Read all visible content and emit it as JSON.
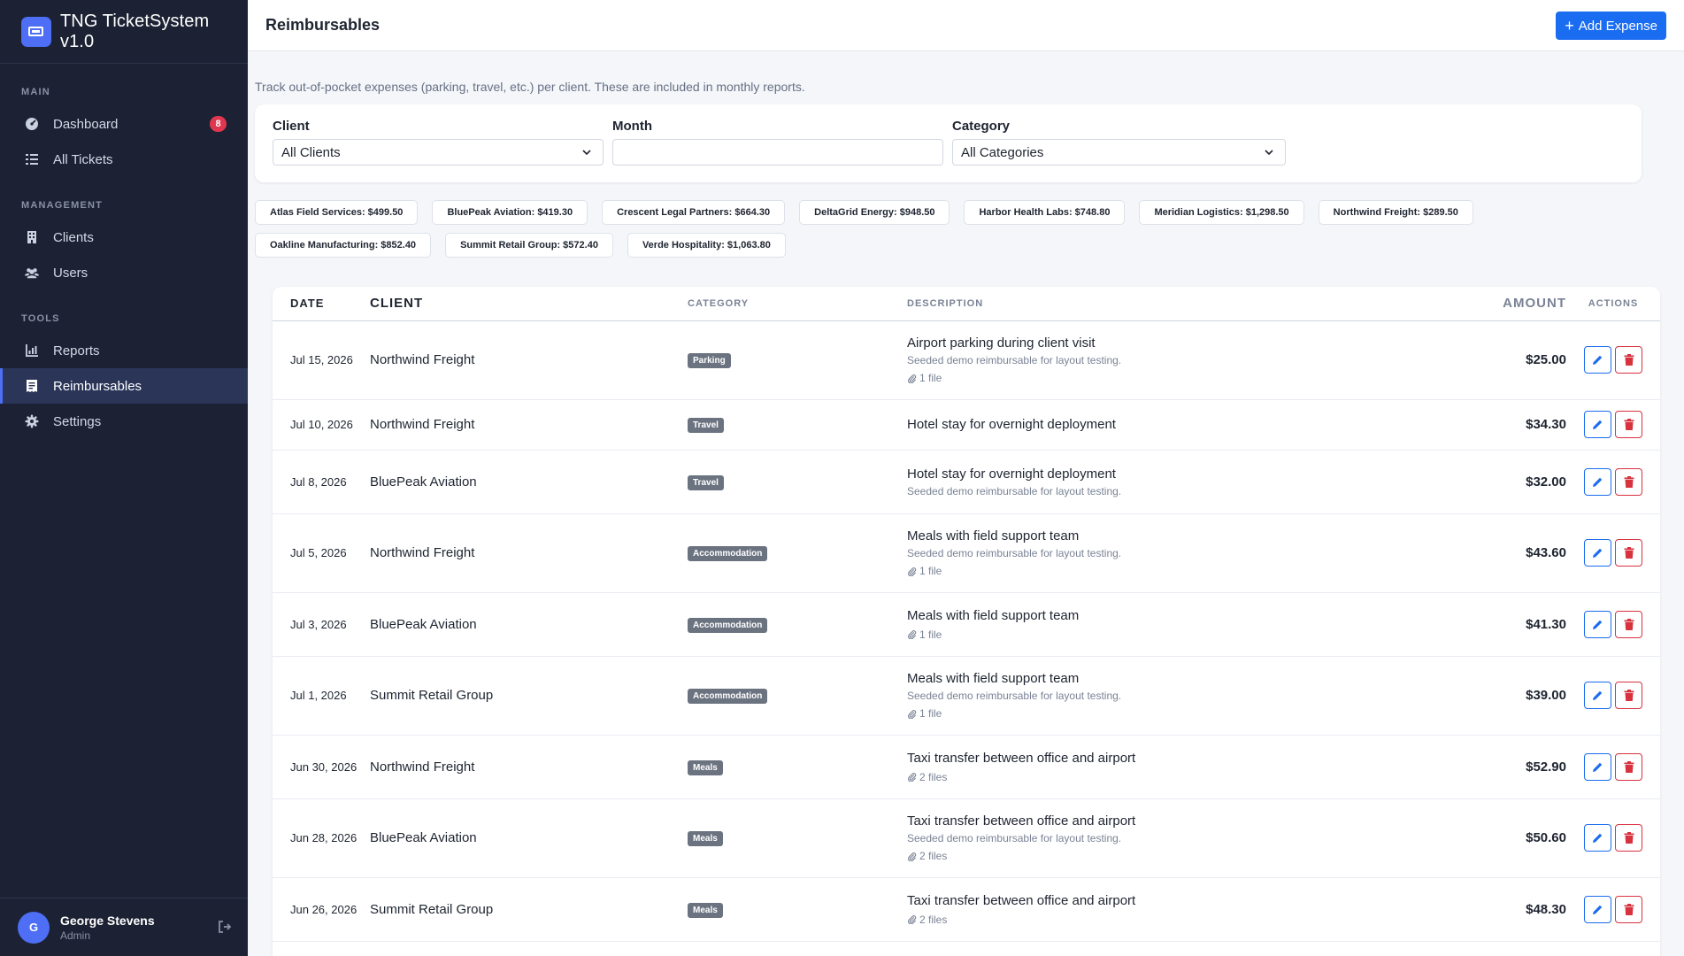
{
  "app": {
    "title": "TNG TicketSystem v1.0"
  },
  "sidebar": {
    "sections": [
      {
        "label": "MAIN",
        "items": [
          {
            "label": "Dashboard",
            "icon": "gauge-icon",
            "badge": "8"
          },
          {
            "label": "All Tickets",
            "icon": "list-icon"
          }
        ]
      },
      {
        "label": "MANAGEMENT",
        "items": [
          {
            "label": "Clients",
            "icon": "building-icon"
          },
          {
            "label": "Users",
            "icon": "users-icon"
          }
        ]
      },
      {
        "label": "TOOLS",
        "items": [
          {
            "label": "Reports",
            "icon": "chart-icon"
          },
          {
            "label": "Reimbursables",
            "icon": "receipt-icon",
            "active": true
          },
          {
            "label": "Settings",
            "icon": "gear-icon"
          }
        ]
      }
    ],
    "user": {
      "initial": "G",
      "name": "George Stevens",
      "role": "Admin"
    }
  },
  "header": {
    "title": "Reimbursables",
    "add_label": "Add Expense"
  },
  "intro": "Track out-of-pocket expenses (parking, travel, etc.) per client. These are included in monthly reports.",
  "filters": {
    "client_label": "Client",
    "client_value": "All Clients",
    "month_label": "Month",
    "month_value": "",
    "category_label": "Category",
    "category_value": "All Categories"
  },
  "totals": [
    "Atlas Field Services: $499.50",
    "BluePeak Aviation: $419.30",
    "Crescent Legal Partners: $664.30",
    "DeltaGrid Energy: $948.50",
    "Harbor Health Labs: $748.80",
    "Meridian Logistics: $1,298.50",
    "Northwind Freight: $289.50",
    "Oakline Manufacturing: $852.40",
    "Summit Retail Group: $572.40",
    "Verde Hospitality: $1,063.80"
  ],
  "table": {
    "columns": [
      "DATE",
      "CLIENT",
      "CATEGORY",
      "DESCRIPTION",
      "AMOUNT",
      "ACTIONS"
    ],
    "rows": [
      {
        "date": "Jul 15, 2026",
        "client": "Northwind Freight",
        "category": "Parking",
        "desc": "Airport parking during client visit",
        "note": "Seeded demo reimbursable for layout testing.",
        "files": "1 file",
        "amount": "$25.00"
      },
      {
        "date": "Jul 10, 2026",
        "client": "Northwind Freight",
        "category": "Travel",
        "desc": "Hotel stay for overnight deployment",
        "note": "",
        "files": "",
        "amount": "$34.30"
      },
      {
        "date": "Jul 8, 2026",
        "client": "BluePeak Aviation",
        "category": "Travel",
        "desc": "Hotel stay for overnight deployment",
        "note": "Seeded demo reimbursable for layout testing.",
        "files": "",
        "amount": "$32.00"
      },
      {
        "date": "Jul 5, 2026",
        "client": "Northwind Freight",
        "category": "Accommodation",
        "desc": "Meals with field support team",
        "note": "Seeded demo reimbursable for layout testing.",
        "files": "1 file",
        "amount": "$43.60"
      },
      {
        "date": "Jul 3, 2026",
        "client": "BluePeak Aviation",
        "category": "Accommodation",
        "desc": "Meals with field support team",
        "note": "",
        "files": "1 file",
        "amount": "$41.30"
      },
      {
        "date": "Jul 1, 2026",
        "client": "Summit Retail Group",
        "category": "Accommodation",
        "desc": "Meals with field support team",
        "note": "Seeded demo reimbursable for layout testing.",
        "files": "1 file",
        "amount": "$39.00"
      },
      {
        "date": "Jun 30, 2026",
        "client": "Northwind Freight",
        "category": "Meals",
        "desc": "Taxi transfer between office and airport",
        "note": "",
        "files": "2 files",
        "amount": "$52.90"
      },
      {
        "date": "Jun 28, 2026",
        "client": "BluePeak Aviation",
        "category": "Meals",
        "desc": "Taxi transfer between office and airport",
        "note": "Seeded demo reimbursable for layout testing.",
        "files": "2 files",
        "amount": "$50.60"
      },
      {
        "date": "Jun 26, 2026",
        "client": "Summit Retail Group",
        "category": "Meals",
        "desc": "Taxi transfer between office and airport",
        "note": "",
        "files": "2 files",
        "amount": "$48.30"
      }
    ]
  },
  "colors": {
    "accent": "#1a6cf0",
    "sidebar": "#1c2234",
    "danger": "#d8323f",
    "badge": "#e0364f"
  }
}
